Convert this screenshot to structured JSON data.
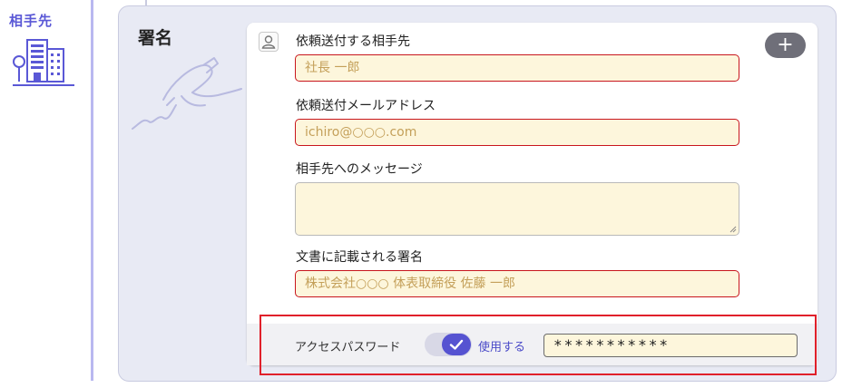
{
  "sidebar": {
    "label": "相手先"
  },
  "section": {
    "title": "署名"
  },
  "form": {
    "recipient_label": "依頼送付する相手先",
    "recipient_placeholder": "社長 一郎",
    "email_label": "依頼送付メールアドレス",
    "email_placeholder": "ichiro@○○○.com",
    "message_label": "相手先へのメッセージ",
    "message_value": "",
    "signature_label": "文書に記載される署名",
    "signature_placeholder": "株式会社○○○ 体表取締役 佐藤 一郎",
    "add_label": "+"
  },
  "password": {
    "label": "アクセスパスワード",
    "toggle_state": "on",
    "use_label": "使用する",
    "value": "***********"
  },
  "colors": {
    "accent": "#5a58d6",
    "input_bg": "#fdf6dc",
    "error_border": "#c8161d",
    "highlight": "#e0202a"
  },
  "icons": [
    "building-icon",
    "signature-illustration",
    "person-icon",
    "plus-icon",
    "check-icon"
  ]
}
